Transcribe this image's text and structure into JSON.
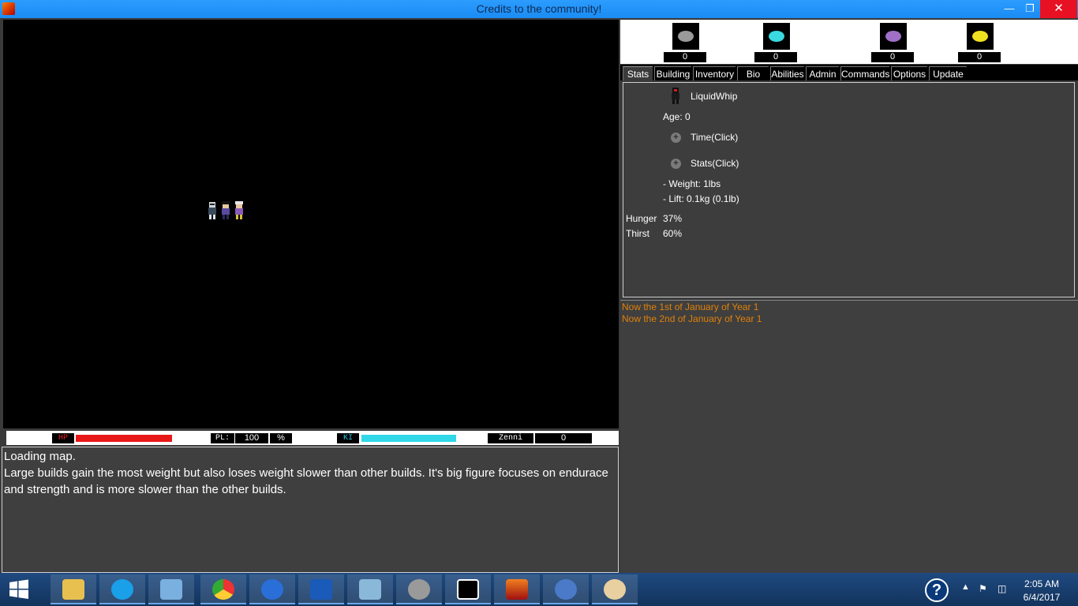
{
  "window": {
    "title": "Credits to the community!",
    "minimize": "—",
    "maximize": "❐",
    "close": "✕"
  },
  "hud": {
    "hp_label": "HP",
    "hp_fill": 1.0,
    "pl_label": "PL:",
    "pl_value": "100",
    "pl_unit": "%",
    "ki_label": "KI",
    "ki_fill": 1.0,
    "zenni_label": "Zenni",
    "zenni_value": "0"
  },
  "log": {
    "lines": [
      "Loading map.",
      "Large builds gain the most weight but also loses weight slower than other builds. It's big figure focuses on endurace and strength and is more slower than the other builds."
    ]
  },
  "resources": [
    {
      "name": "stone-resource-icon",
      "value": "0",
      "color": "#9a9a9a"
    },
    {
      "name": "diamond-resource-icon",
      "value": "0",
      "color": "#3ad8e0"
    },
    {
      "name": "amethyst-resource-icon",
      "value": "0",
      "color": "#a070c8"
    },
    {
      "name": "gold-resource-icon",
      "value": "0",
      "color": "#f0e020"
    }
  ],
  "tabs": [
    "Stats",
    "Building",
    "Inventory",
    "Bio",
    "Abilities",
    "Admin",
    "Commands",
    "Options",
    "Update"
  ],
  "stats": {
    "name": "LiquidWhip",
    "age": "Age: 0",
    "time_link": "Time(Click)",
    "stats_link": "Stats(Click)",
    "weight": "- Weight: 1lbs",
    "lift": "- Lift: 0.1kg (0.1lb)",
    "hunger_label": "Hunger",
    "hunger_value": "37%",
    "thirst_label": "Thirst",
    "thirst_value": "60%"
  },
  "events": [
    "Now the 1st of January of Year 1",
    "Now the 2nd of January of Year 1"
  ],
  "taskbar": {
    "help": "?",
    "tray_up": "▲",
    "tray_flag": "⚑",
    "tray_volume": "◫",
    "time": "2:05 AM",
    "date": "6/4/2017"
  }
}
